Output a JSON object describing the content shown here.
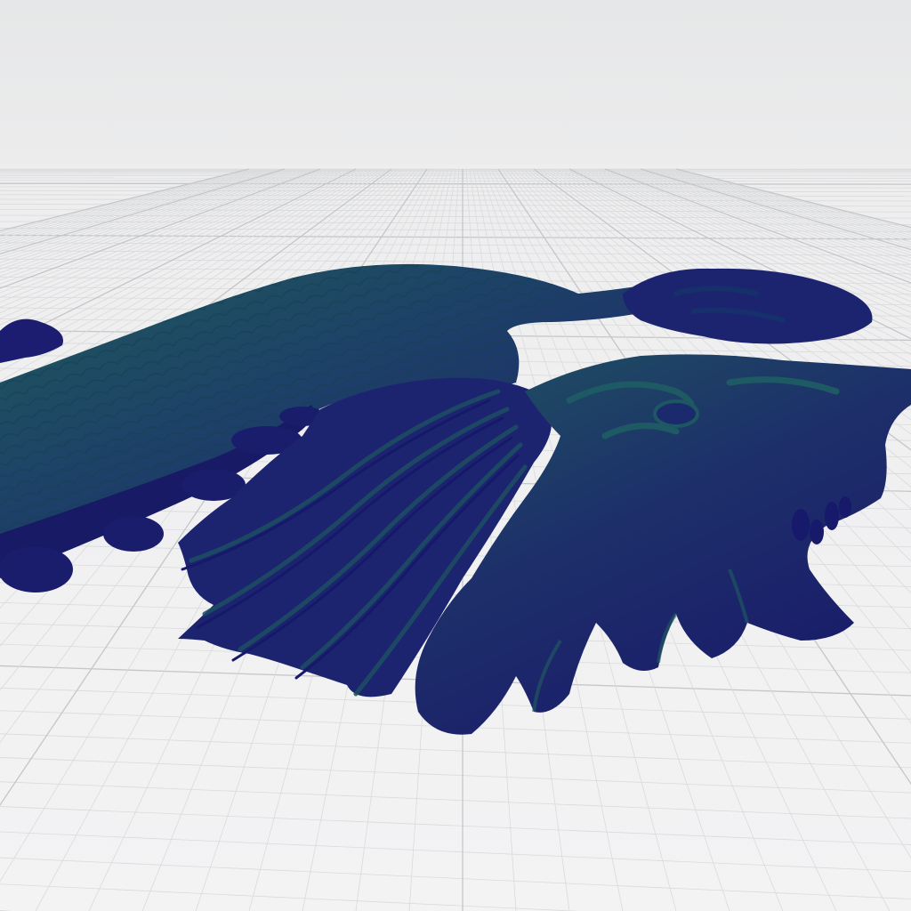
{
  "viewport": {
    "background_sky": "#e8e9ea",
    "background_floor": "#f1f1f2",
    "grid_minor_color": "#d9dadc",
    "grid_major_color": "#c4c6c9",
    "model": {
      "name": "dragon-relief",
      "color_base": "#1e1f6e",
      "color_highlight": "#1f5a5c",
      "color_shadow": "#15155a"
    }
  }
}
